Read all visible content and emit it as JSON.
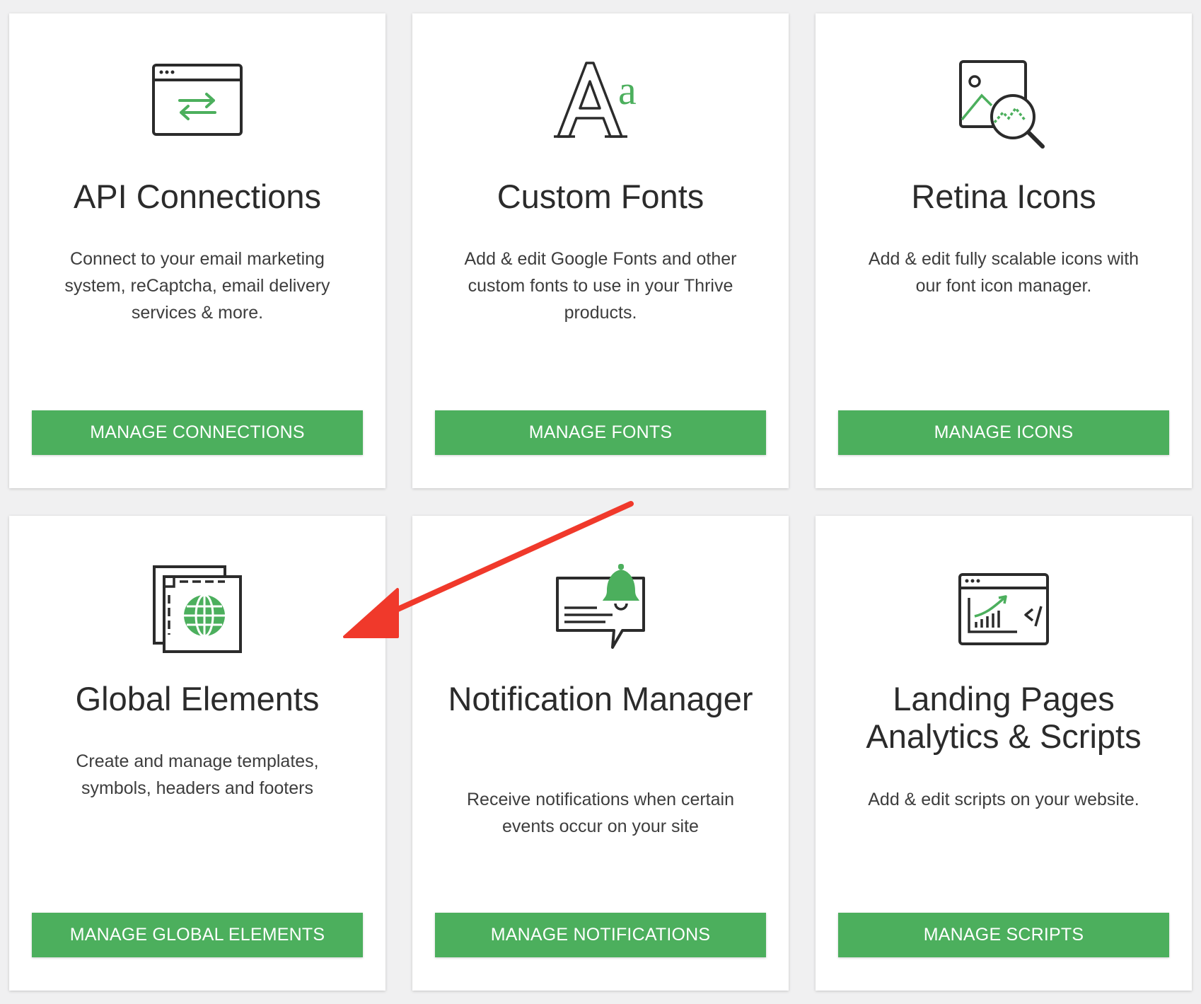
{
  "colors": {
    "accent": "#4caf5d",
    "page_bg": "#f0f0f1",
    "card_bg": "#ffffff",
    "title": "#2b2b2b",
    "body_text": "#3d3d3d",
    "annotation_arrow": "#f0392b"
  },
  "cards": [
    {
      "icon": "api-window-arrows-icon",
      "title": "API Connections",
      "description": "Connect to your email marketing system, reCaptcha, email delivery services & more.",
      "button_label": "MANAGE CONNECTIONS"
    },
    {
      "icon": "font-aa-icon",
      "title": "Custom Fonts",
      "description": "Add & edit Google Fonts and other custom fonts to use in your Thrive products.",
      "button_label": "MANAGE FONTS"
    },
    {
      "icon": "image-magnifier-icon",
      "title": "Retina Icons",
      "description": "Add & edit fully scalable icons with our font icon manager.",
      "button_label": "MANAGE ICONS"
    },
    {
      "icon": "global-window-icon",
      "title": "Global Elements",
      "description": "Create and manage templates, symbols, headers and footers",
      "button_label": "MANAGE GLOBAL ELEMENTS"
    },
    {
      "icon": "notification-bell-icon",
      "title": "Notification Manager",
      "description": "Receive notifications when certain events occur on your site",
      "button_label": "MANAGE NOTIFICATIONS"
    },
    {
      "icon": "analytics-code-icon",
      "title": "Landing Pages Analytics & Scripts",
      "description": "Add & edit scripts on your website.",
      "button_label": "MANAGE SCRIPTS"
    }
  ]
}
